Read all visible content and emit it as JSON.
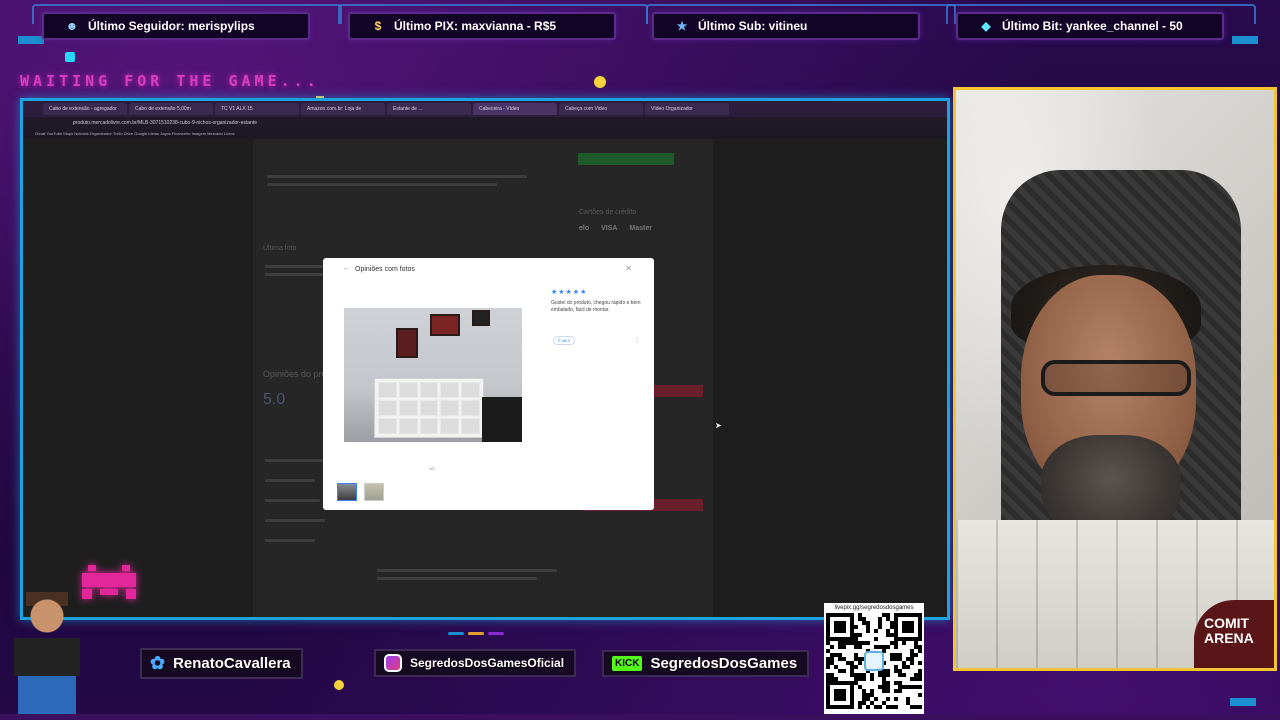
{
  "overlay": {
    "alerts": [
      {
        "label": "Último Seguidor: merispylips",
        "icon": "user-icon"
      },
      {
        "label": "Último PIX: maxvianna - R$5",
        "icon": "dollar-icon"
      },
      {
        "label": "Último Sub: vitineu",
        "icon": "star-icon"
      },
      {
        "label": "Último Bit: yankee_channel - 50",
        "icon": "gem-icon"
      }
    ],
    "waiting_text": "WAITING FOR THE GAME...",
    "socials": [
      {
        "name": "RenatoCavallera",
        "icon": "twitter-icon"
      },
      {
        "name": "SegredosDosGamesOficial",
        "icon": "instagram-icon"
      },
      {
        "name": "SegredosDosGames",
        "icon": "kick-icon",
        "badge": "KICK"
      }
    ],
    "qr_label": "livepix.gg/segredosdosgames",
    "cam_shirt_text": "COMIT ARENA",
    "colors": {
      "accent_cyan": "#1ca3e0",
      "cam_border": "#f3c52e",
      "waiting": "#d63cc4"
    }
  },
  "browser": {
    "tabs": [
      "Cabo de extensão - agregador",
      "Cabo de extensão 5,00m",
      "TC V1 ALX 15",
      "Amazon.com.br: Loja de",
      "Estante de ...",
      "Cabeceira - Vídeo",
      "Cabeça com Video",
      "Vídeo Organizador"
    ],
    "address": "produto.mercadolivre.com.br/MLB-3071510238-cubo-9-nichos-organizador-estante",
    "bookmarks": "Gmail  YouTube  Maps  Notícias  Organizador  Trello  Drive  Google  Ideias  Jogos  Financeiro  Imagem  Mercado  Livros"
  },
  "page": {
    "section_title": "Última foto",
    "reviews_heading": "Opiniões do produto",
    "rating": "5.0",
    "payment_label": "Cartões de crédito",
    "card_brands": [
      "elo",
      "VISA",
      "Master"
    ]
  },
  "modal": {
    "title": "Opiniões com fotos",
    "stars": "★★★★★",
    "review_text": "Gostei do produto, chegou rápido e bem embalado, fácil de montar.",
    "helpful_label": "É útil 0",
    "counter": "1/2"
  }
}
